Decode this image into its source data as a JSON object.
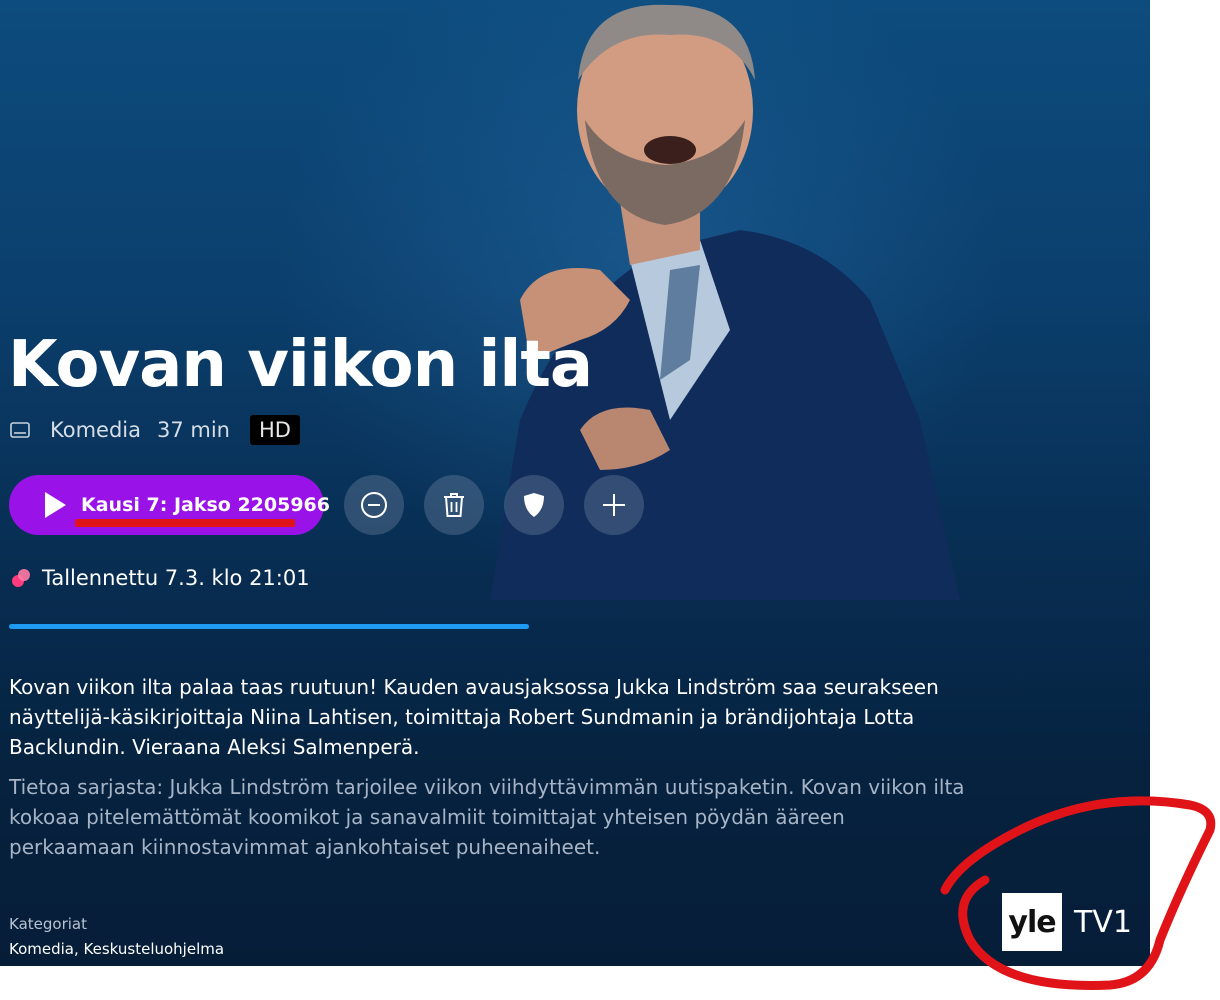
{
  "program": {
    "title": "Kovan viikon ilta",
    "genre": "Komedia",
    "duration": "37 min",
    "quality_badge": "HD"
  },
  "actions": {
    "play_label": "Kausi 7: Jakso 2205966",
    "icons": [
      "play-icon",
      "minus-circle-icon",
      "trash-icon",
      "shield-icon",
      "plus-icon"
    ]
  },
  "recording": {
    "status": "Tallennettu 7.3. klo 21:01",
    "progress_percent": 100
  },
  "description": {
    "episode": "Kovan viikon ilta palaa taas ruutuun! Kauden avausjaksossa Jukka Lindström saa seurakseen näyttelijä-käsikirjoittaja Niina Lahtisen, toimittaja Robert Sundmanin ja brändijohtaja Lotta Backlundin. Vieraana Aleksi Salmenperä.",
    "series": "Tietoa sarjasta: Jukka Lindström tarjoilee viikon viihdyttävimmän uutispaketin. Kovan viikon ilta kokoaa pitelemättömät koomikot ja sanavalmiit toimittajat yhteisen pöydän ääreen perkaamaan kiinnostavimmat ajankohtaiset puheenaiheet."
  },
  "categories": {
    "label": "Kategoriat",
    "value": "Komedia, Keskusteluohjelma"
  },
  "channel": {
    "logo_text": "yle",
    "name": "TV1"
  },
  "colors": {
    "play_button": "#9913e8",
    "progress": "#1e9bf0",
    "annotation": "#e01418",
    "background": "#0b3f6d"
  }
}
